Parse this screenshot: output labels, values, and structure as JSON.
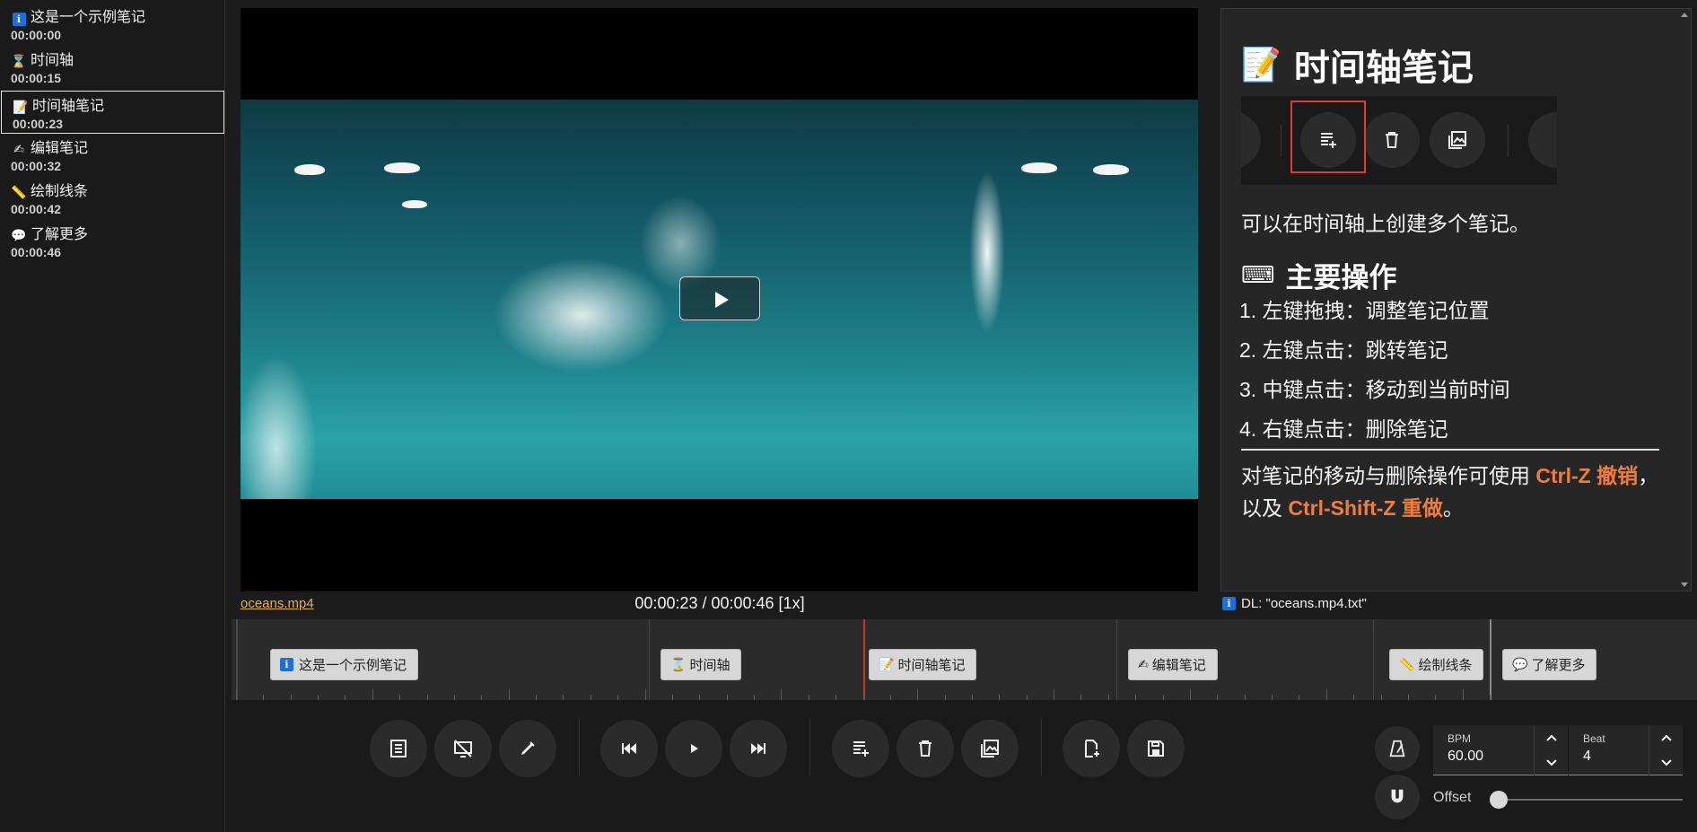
{
  "sidebar": {
    "items": [
      {
        "emoji": "ℹ",
        "title": "这是一个示例笔记",
        "time": "00:00:00",
        "active": false
      },
      {
        "emoji": "⌛",
        "title": "时间轴",
        "time": "00:00:15",
        "active": false
      },
      {
        "emoji": "📝",
        "title": "时间轴笔记",
        "time": "00:00:23",
        "active": true
      },
      {
        "emoji": "✍",
        "title": "编辑笔记",
        "time": "00:00:32",
        "active": false
      },
      {
        "emoji": "📏",
        "title": "绘制线条",
        "time": "00:00:42",
        "active": false
      },
      {
        "emoji": "💬",
        "title": "了解更多",
        "time": "00:00:46",
        "active": false
      }
    ]
  },
  "video": {
    "file_name": "oceans.mp4",
    "time_display": "00:00:23 / 00:00:46 [1x]"
  },
  "note": {
    "heading_emoji": "📝",
    "heading": "时间轴笔记",
    "description": "可以在时间轴上创建多个笔记。",
    "ops_emoji": "⌨",
    "ops_heading": "主要操作",
    "ops": [
      "1. 左键拖拽：调整笔记位置",
      "2. 左键点击：跳转笔记",
      "3. 中键点击：移动到当前时间",
      "4. 右键点击：删除笔记"
    ],
    "undo_pre": "对笔记的移动与删除操作可使用 ",
    "undo_key1": "Ctrl-Z 撤销",
    "undo_mid": "，以及 ",
    "undo_key2": "Ctrl-Shift-Z 重做",
    "undo_post": "。"
  },
  "status": {
    "info_icon": "i",
    "dl_text": "DL: \"oceans.mp4.txt\""
  },
  "timeline": {
    "chips": [
      {
        "emoji": "ℹ",
        "label": "这是一个示例笔记"
      },
      {
        "emoji": "⌛",
        "label": "时间轴"
      },
      {
        "emoji": "📝",
        "label": "时间轴笔记"
      },
      {
        "emoji": "✍",
        "label": "编辑笔记"
      },
      {
        "emoji": "📏",
        "label": "绘制线条"
      },
      {
        "emoji": "💬",
        "label": "了解更多"
      }
    ],
    "current_time": "00:00:23",
    "duration": "00:00:46"
  },
  "controls": {
    "bpm_label": "BPM",
    "bpm_value": "60.00",
    "beat_label": "Beat",
    "beat_value": "4",
    "offset_label": "Offset",
    "offset_value_fraction": 0.0
  },
  "colors": {
    "accent_orange": "#ef7d3c",
    "playhead_red": "#c0392b",
    "highlight_red": "#e53935",
    "link_gold": "#e0b25a",
    "info_blue": "#1e6fd9"
  }
}
